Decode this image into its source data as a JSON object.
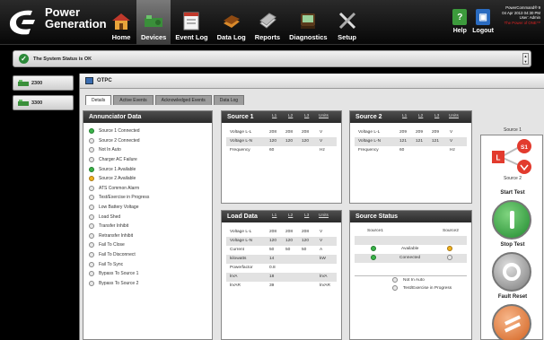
{
  "brand": {
    "line1": "Power",
    "line2": "Generation"
  },
  "nav": [
    {
      "label": "Home",
      "icon": "home-icon"
    },
    {
      "label": "Devices",
      "icon": "devices-icon",
      "active": true
    },
    {
      "label": "Event Log",
      "icon": "event-log-icon"
    },
    {
      "label": "Data Log",
      "icon": "data-log-icon"
    },
    {
      "label": "Reports",
      "icon": "reports-icon"
    },
    {
      "label": "Diagnostics",
      "icon": "diagnostics-icon"
    },
    {
      "label": "Setup",
      "icon": "setup-icon"
    }
  ],
  "help": {
    "label": "Help",
    "logout_label": "Logout"
  },
  "info_box": {
    "line1": "PowerCommand® 9",
    "line2": "04 Apr 2013 04:30 PM",
    "line3": "User: Admin",
    "line4": "The Power of ONE™"
  },
  "status": {
    "text": "The System Status is OK"
  },
  "units": [
    {
      "label": "2300"
    },
    {
      "label": "3300"
    }
  ],
  "device": {
    "name": "OTPC"
  },
  "tabs": [
    {
      "label": "Details",
      "active": true
    },
    {
      "label": "Active Events"
    },
    {
      "label": "Acknowledged Events"
    },
    {
      "label": "Data Log"
    }
  ],
  "annunciator": {
    "title": "Annunciator Data",
    "items": [
      {
        "label": "Source 1 Connected",
        "state": "green"
      },
      {
        "label": "Source 2 Connected",
        "state": "off"
      },
      {
        "label": "Not In Auto",
        "state": "off"
      },
      {
        "label": "Charger AC Failure",
        "state": "off"
      },
      {
        "label": "Source 1 Available",
        "state": "green"
      },
      {
        "label": "Source 2 Available",
        "state": "amber"
      },
      {
        "label": "ATS Common Alarm",
        "state": "off"
      },
      {
        "label": "Test/Exercise in Progress",
        "state": "off"
      },
      {
        "label": "Low Battery Voltage",
        "state": "off"
      },
      {
        "label": "Load Shed",
        "state": "off"
      },
      {
        "label": "Transfer Inhibit",
        "state": "off"
      },
      {
        "label": "Retransfer Inhibit",
        "state": "off"
      },
      {
        "label": "Fail To Close",
        "state": "off"
      },
      {
        "label": "Fail To Disconnect",
        "state": "off"
      },
      {
        "label": "Fail To Sync",
        "state": "off"
      },
      {
        "label": "Bypass To Source 1",
        "state": "off"
      },
      {
        "label": "Bypass To Source 2",
        "state": "off"
      }
    ]
  },
  "source1": {
    "title": "Source 1",
    "headers": [
      "L1",
      "L2",
      "L3",
      "Units"
    ],
    "rows": [
      {
        "label": "Voltage L-L",
        "l1": "208",
        "l2": "208",
        "l3": "208",
        "unit": "V"
      },
      {
        "label": "Voltage L-N",
        "l1": "120",
        "l2": "120",
        "l3": "120",
        "unit": "V"
      },
      {
        "label": "Frequency",
        "l1": "60",
        "l2": "",
        "l3": "",
        "unit": "Hz"
      }
    ]
  },
  "source2": {
    "title": "Source 2",
    "headers": [
      "L1",
      "L2",
      "L3",
      "Units"
    ],
    "rows": [
      {
        "label": "Voltage L-L",
        "l1": "209",
        "l2": "209",
        "l3": "209",
        "unit": "V"
      },
      {
        "label": "Voltage L-N",
        "l1": "121",
        "l2": "121",
        "l3": "121",
        "unit": "V"
      },
      {
        "label": "Frequency",
        "l1": "60",
        "l2": "",
        "l3": "",
        "unit": "Hz"
      }
    ]
  },
  "load": {
    "title": "Load Data",
    "headers": [
      "L1",
      "L2",
      "L3",
      "Units"
    ],
    "rows": [
      {
        "label": "Voltage L-L",
        "l1": "208",
        "l2": "208",
        "l3": "208",
        "unit": "V"
      },
      {
        "label": "Voltage L-N",
        "l1": "120",
        "l2": "120",
        "l3": "120",
        "unit": "V"
      },
      {
        "label": "Current",
        "l1": "50",
        "l2": "50",
        "l3": "50",
        "unit": "A"
      },
      {
        "label": "kilowatts",
        "l1": "14",
        "l2": "",
        "l3": "",
        "unit": "kW"
      },
      {
        "label": "Powerfactor",
        "l1": "0.8",
        "l2": "",
        "l3": "",
        "unit": ""
      },
      {
        "label": "kVA",
        "l1": "18",
        "l2": "",
        "l3": "",
        "unit": "kVA"
      },
      {
        "label": "kVAR",
        "l1": "39",
        "l2": "",
        "l3": "",
        "unit": "kVAR"
      }
    ]
  },
  "source_status": {
    "title": "Source Status",
    "source1_label": "Source1",
    "source2_label": "Source2",
    "available_label": "Available",
    "connected_label": "Connected",
    "not_in_auto_label": "Not In Auto",
    "test_label": "Test/Exercise in Progress"
  },
  "controls": {
    "source1_label": "Source 1",
    "source2_label": "Source 2",
    "s1_badge": "S1",
    "l_badge": "L",
    "start_test_label": "Start Test",
    "stop_test_label": "Stop Test",
    "fault_reset_label": "Fault Reset"
  },
  "colors": {
    "green": "#3bb34a",
    "amber": "#f0b21e",
    "red": "#e23b2e"
  }
}
